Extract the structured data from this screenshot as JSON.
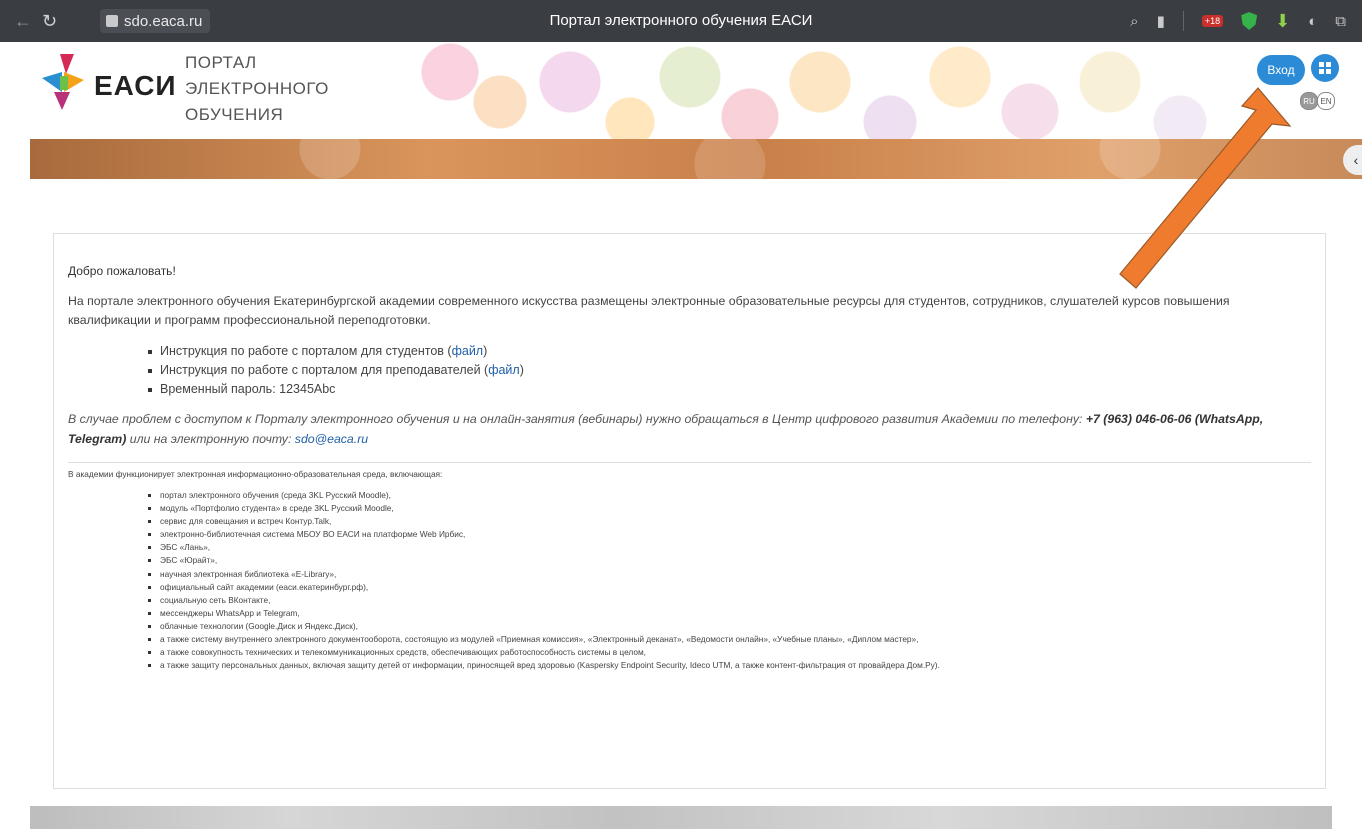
{
  "browser": {
    "address": "sdo.eaca.ru",
    "tab_title": "Портал электронного обучения ЕАСИ",
    "badge_18": "+18",
    "back_icon": "back-arrow-icon",
    "reload_icon": "reload-icon"
  },
  "header": {
    "logo_text": "ЕАСИ",
    "portal_line1": "ПОРТАЛ",
    "portal_line2": "ЭЛЕКТРОННОГО",
    "portal_line3": "ОБУЧЕНИЯ",
    "login_label": "Вход",
    "lang_ru": "RU",
    "lang_en": "EN",
    "toggle": "‹"
  },
  "content": {
    "welcome": "Добро пожаловать!",
    "intro": "На портале электронного обучения Екатеринбургской академии современного искусства размещены электронные образовательные ресурсы для студентов, сотрудников, слушателей курсов повышения квалификации и программ профессиональной переподготовки.",
    "links": [
      {
        "text": "Инструкция по работе с порталом для студентов (",
        "link": "файл",
        "after": ")"
      },
      {
        "text": "Инструкция по работе с порталом для преподавателей (",
        "link": "файл",
        "after": ")"
      },
      {
        "text": "Временный пароль: 12345Abc",
        "link": "",
        "after": ""
      }
    ],
    "support_text": "В случае проблем с доступом к Порталу электронного обучения и на онлайн-занятия (вебинары) нужно обращаться в Центр цифрового развития Академии по телефону: ",
    "support_phone": "+7 (963) 046-06-06 (WhatsApp, Telegram)",
    "support_or": " или на электронную почту: ",
    "support_email": "sdo@eaca.ru",
    "env_title": "В академии функционирует электронная информационно-образовательная среда, включающая:",
    "env_items": [
      "портал электронного обучения (среда 3KL Русский Moodle),",
      "модуль «Портфолио студента» в среде 3KL Русский Moodle,",
      "сервис для совещания и встреч Контур.Talk,",
      "электронно-библиотечная система МБОУ ВО ЕАСИ на платформе Web Ирбис,",
      "ЭБС «Лань»,",
      "ЭБС «Юрайт»,",
      "научная электронная библиотека «E-Library»,",
      "официальный сайт академии (еаси.екатеринбург.рф),",
      "социальную сеть ВКонтакте,",
      "мессенджеры WhatsApp и Telegram,",
      "облачные технологии (Google.Диск и Яндекс.Диск),",
      "а также систему внутреннего электронного документооборота, состоящую из модулей «Приемная комиссия», «Электронный деканат», «Ведомости онлайн», «Учебные планы», «Диплом мастер»,",
      "а также совокупность технических и телекоммуникационных средств, обеспечивающих работоспособность системы в целом,",
      "а также защиту персональных данных, включая защиту детей от информации, приносящей вред здоровью (Kaspersky Endpoint Security, Ideco UTM, а также контент-фильтрация от провайдера Дом.Ру)."
    ]
  },
  "colors": {
    "accent_blue": "#2b8bd6",
    "arrow_orange": "#ee7b2e",
    "browser_bar": "#3a3d42"
  }
}
